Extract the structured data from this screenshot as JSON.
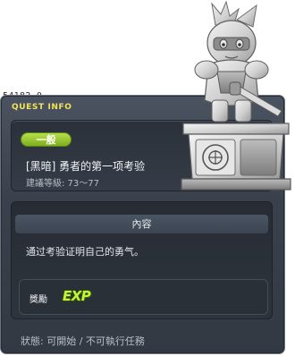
{
  "quest": {
    "id": "54182-0",
    "window_title": "QUEST INFO",
    "type_badge": "一般",
    "name": "[黑暗] 勇者的第一项考验",
    "level_line": "建議等級: 73〜77",
    "content_header": "內容",
    "description": "通过考验证明自己的勇气。",
    "reward_label": "獎勵",
    "reward_icon": "EXP",
    "status_line": "狀態: 可開始 / 不可執行任務"
  },
  "icons": {
    "reward": "exp-icon",
    "statue": "knight-statue-icon"
  },
  "colors": {
    "title_yellow": "#f3e35a",
    "badge_green": "#9ccd33",
    "exp_green": "#c8f23a",
    "panel_dark": "#333943"
  }
}
